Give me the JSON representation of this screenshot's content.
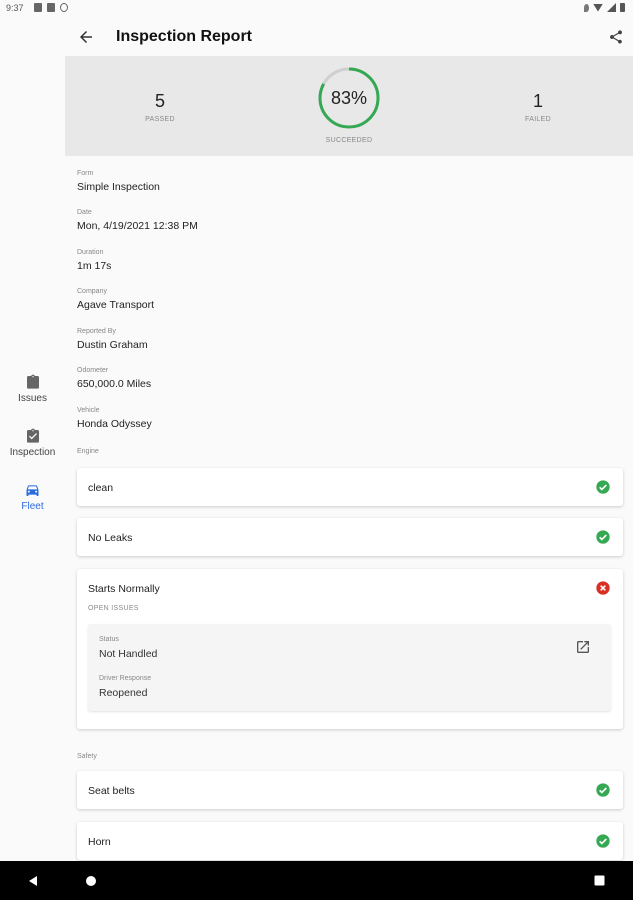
{
  "statusbar": {
    "time": "9:37"
  },
  "sidebar": {
    "items": [
      {
        "label": "Issues",
        "icon": "clipboard-icon"
      },
      {
        "label": "Inspection",
        "icon": "clipboard-check-icon"
      },
      {
        "label": "Fleet",
        "icon": "car-icon",
        "active": true
      }
    ]
  },
  "appbar": {
    "title": "Inspection Report",
    "back_icon": "arrow-back-icon",
    "share_icon": "share-icon"
  },
  "summary": {
    "passed": {
      "value": "5",
      "label": "PASSED"
    },
    "succeeded": {
      "value": "83%",
      "label": "SUCCEEDED",
      "fraction": 0.83
    },
    "failed": {
      "value": "1",
      "label": "FAILED"
    }
  },
  "fields": [
    {
      "label": "Form",
      "value": "Simple Inspection"
    },
    {
      "label": "Date",
      "value": "Mon, 4/19/2021 12:38 PM"
    },
    {
      "label": "Duration",
      "value": "1m 17s"
    },
    {
      "label": "Company",
      "value": "Agave Transport"
    },
    {
      "label": "Reported By",
      "value": "Dustin Graham"
    },
    {
      "label": "Odometer",
      "value": "650,000.0 Miles"
    },
    {
      "label": "Vehicle",
      "value": "Honda Odyssey"
    }
  ],
  "sections": {
    "engine": {
      "label": "Engine",
      "items": [
        {
          "label": "clean",
          "status": "passed"
        },
        {
          "label": "No Leaks",
          "status": "passed"
        },
        {
          "label": "Starts Normally",
          "status": "failed"
        }
      ],
      "open_issues": {
        "label": "OPEN ISSUES",
        "status_label": "Status",
        "status_value": "Not Handled",
        "response_label": "Driver Response",
        "response_value": "Reopened"
      }
    },
    "safety": {
      "label": "Safety",
      "items": [
        {
          "label": "Seat belts",
          "status": "passed"
        },
        {
          "label": "Horn",
          "status": "passed"
        }
      ]
    }
  },
  "colors": {
    "pass": "#34a853",
    "fail": "#d93025",
    "accent": "#2b6be0",
    "ring_track": "#cfcfcf"
  }
}
